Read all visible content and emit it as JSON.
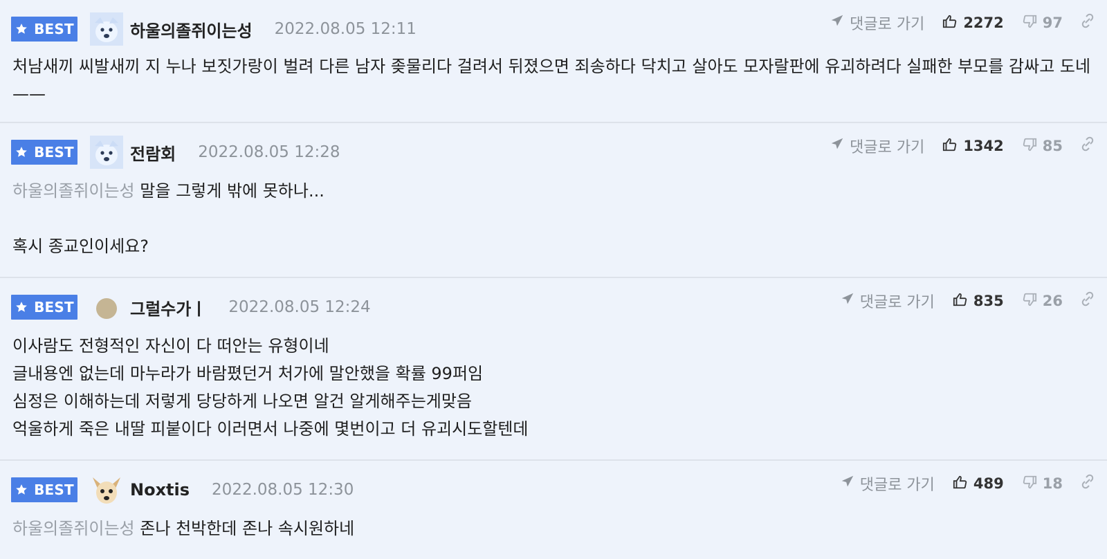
{
  "ui": {
    "best_badge_label": "BEST",
    "reply_label": "댓글로 가기",
    "icons": {
      "best": "star-icon",
      "reply": "send-icon",
      "like": "thumbs-up-icon",
      "dislike": "thumbs-down-icon",
      "link": "link-icon"
    },
    "colors": {
      "background": "#eef3fb",
      "best_badge": "#4a7fe6",
      "muted_text": "#8d939a",
      "divider": "#dde2ea"
    }
  },
  "comments": [
    {
      "avatar": "dog-avatar",
      "nickname": "하울의졸쥐이는성",
      "date": "2022.08.05 12:11",
      "likes": "2272",
      "dislikes": "97",
      "mention": "",
      "body": "처남새끼 씨발새끼 지 누나 보짓가랑이 벌려 다른 남자 좆물리다 걸려서 뒤졌으면 죄송하다 닥치고 살아도 모자랄판에 유괴하려다 실패한 부모를 감싸고 도네 ——"
    },
    {
      "avatar": "dog-avatar",
      "nickname": "전람회",
      "date": "2022.08.05 12:28",
      "likes": "1342",
      "dislikes": "85",
      "mention": "하울의졸쥐이는성",
      "body": "말을 그렇게 밖에 못하나...\n\n혹시 종교인이세요?"
    },
    {
      "avatar": "dot-avatar",
      "nickname": "그럴수가ㅣ",
      "date": "2022.08.05 12:24",
      "likes": "835",
      "dislikes": "26",
      "mention": "",
      "body": "이사람도 전형적인 자신이 다 떠안는 유형이네\n글내용엔 없는데 마누라가 바람폈던거 처가에 말안했을 확률 99퍼임\n심정은 이해하는데 저렇게 당당하게 나오면 알건 알게해주는게맞음\n억울하게 죽은 내딸 피붙이다 이러면서 나중에 몇번이고 더 유괴시도할텐데"
    },
    {
      "avatar": "chihuahua-avatar",
      "nickname": "Noxtis",
      "date": "2022.08.05 12:30",
      "likes": "489",
      "dislikes": "18",
      "mention": "하울의졸쥐이는성",
      "body": "존나 천박한데 존나 속시원하네"
    }
  ]
}
